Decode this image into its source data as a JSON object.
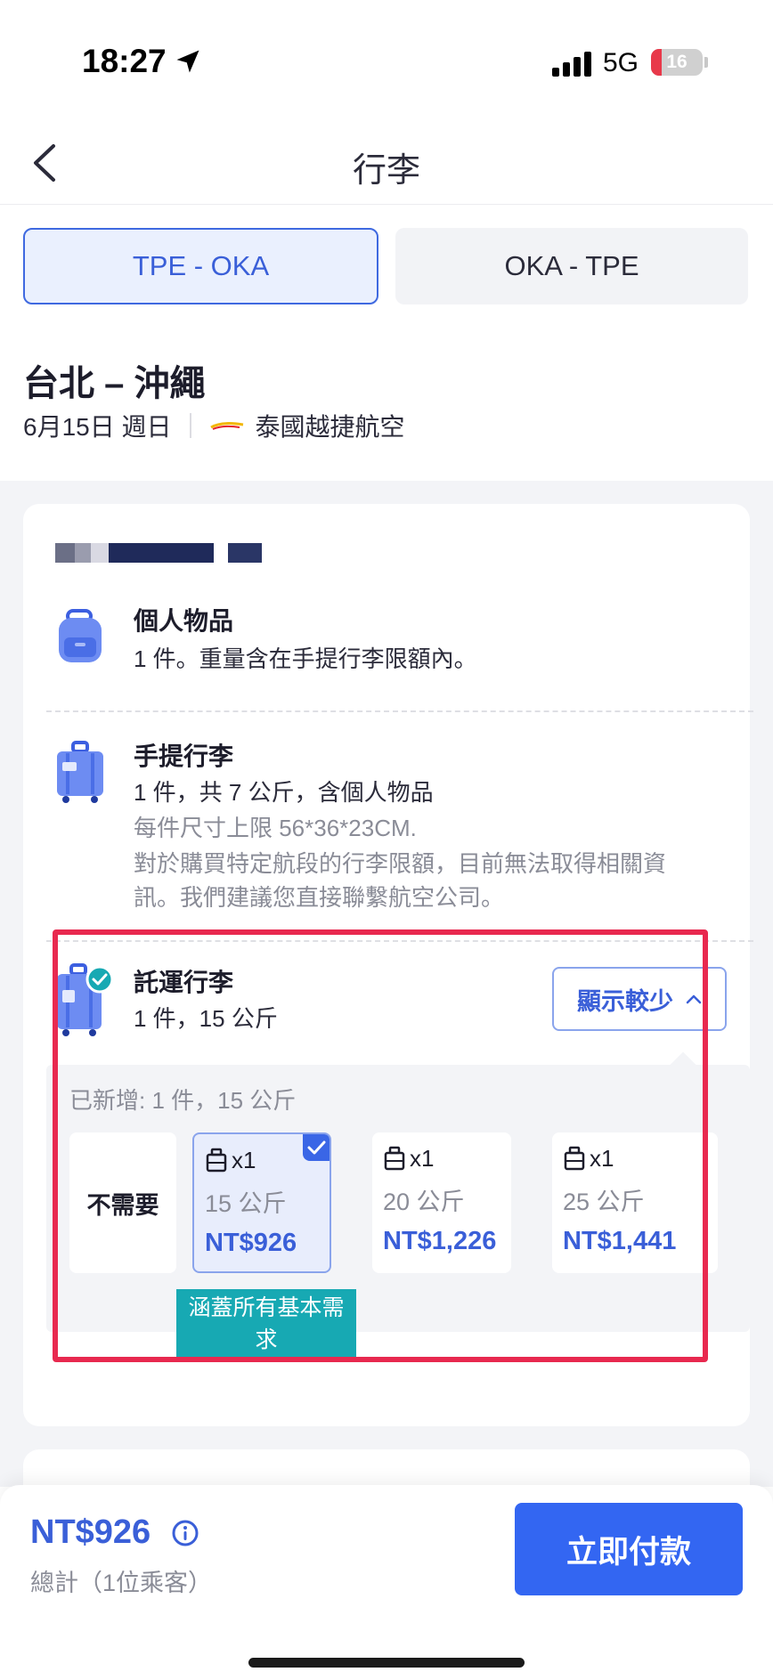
{
  "status_bar": {
    "time": "18:27",
    "network": "5G",
    "battery": "16"
  },
  "nav": {
    "title": "行李"
  },
  "route_tabs": [
    {
      "label": "TPE - OKA",
      "active": true
    },
    {
      "label": "OKA - TPE",
      "active": false
    }
  ],
  "flight": {
    "title": "台北 – 沖繩",
    "date": "6月15日 週日",
    "airline": "泰國越捷航空"
  },
  "baggage": {
    "personal": {
      "title": "個人物品",
      "line1": "1 件。重量含在手提行李限額內。"
    },
    "carry_on": {
      "title": "手提行李",
      "line1": "1 件，共 7 公斤，含個人物品",
      "line2": "每件尺寸上限 56*36*23CM.",
      "line3": "對於購買特定航段的行李限額，目前無法取得相關資",
      "line4": "訊。我們建議您直接聯繫航空公司。"
    },
    "checked": {
      "title": "託運行李",
      "line1": "1 件，15 公斤",
      "toggle_label": "顯示較少",
      "added_label": "已新增:  1 件，15 公斤",
      "none_label": "不需要",
      "options": [
        {
          "qty": "x1",
          "weight": "15 公斤",
          "price": "NT$926",
          "selected": true
        },
        {
          "qty": "x1",
          "weight": "20 公斤",
          "price": "NT$1,226",
          "selected": false
        },
        {
          "qty": "x1",
          "weight": "25 公斤",
          "price": "NT$1,441",
          "selected": false
        }
      ],
      "recommend_line1": "涵蓋所有基本需",
      "recommend_line2": "求"
    }
  },
  "footer": {
    "total_price": "NT$926",
    "total_sub": "總計（1位乘客）",
    "pay_label": "立即付款"
  },
  "colors": {
    "accent": "#3a5fd8",
    "pay_button": "#3366f2",
    "highlight": "#e8294f",
    "recommend": "#17a9b3"
  }
}
